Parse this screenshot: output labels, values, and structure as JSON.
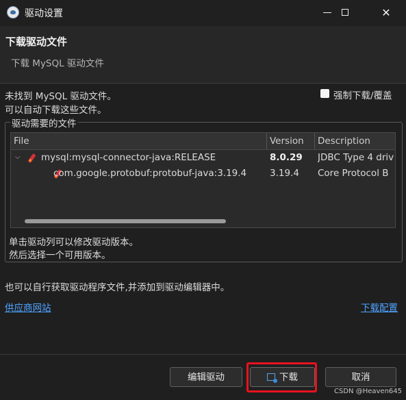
{
  "window": {
    "title": "驱动设置"
  },
  "header": {
    "title": "下载驱动文件",
    "subtitle": "下载 MySQL 驱动文件"
  },
  "messages": {
    "line1": "未找到 MySQL 驱动文件。",
    "line2": "可以自动下载这些文件。",
    "force_download": "强制下载/覆盖"
  },
  "group": {
    "legend": "驱动需要的文件",
    "columns": [
      "File",
      "Version",
      "Description"
    ],
    "rows": [
      {
        "file": "mysql:mysql-connector-java:RELEASE",
        "version": "8.0.29",
        "description": "JDBC Type 4 driv",
        "expanded": true,
        "icon": "jar-icon"
      },
      {
        "file": "com.google.protobuf:protobuf-java:3.19.4",
        "version": "3.19.4",
        "description": "Core Protocol B",
        "icon": "jar-icon"
      }
    ],
    "hint1": "单击驱动列可以修改驱动版本。",
    "hint2": "然后选择一个可用版本。"
  },
  "info": "也可以自行获取驱动程序文件,并添加到驱动编辑器中。",
  "links": {
    "vendor_site": "供应商网站",
    "download_config": "下载配置"
  },
  "buttons": {
    "edit_driver": "编辑驱动",
    "download": "下载",
    "cancel": "取消"
  },
  "watermark": "CSDN @Heaven645",
  "colors": {
    "link": "#4ea3ff",
    "highlight": "#e8121f",
    "jar": "#d4303a"
  }
}
